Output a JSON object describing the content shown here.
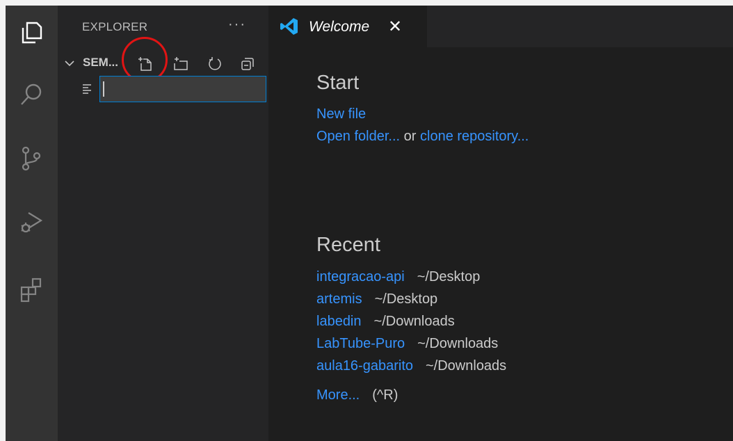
{
  "sidebar": {
    "title": "EXPLORER",
    "more_actions": "···",
    "folder_name": "SEM...",
    "new_file_input_value": ""
  },
  "tab": {
    "label": "Welcome",
    "close": "✕"
  },
  "welcome": {
    "start_heading": "Start",
    "new_file": "New file",
    "open_folder": "Open folder...",
    "or_text": "or",
    "clone_repository": "clone repository...",
    "recent_heading": "Recent",
    "recent": [
      {
        "name": "integracao-api",
        "path": "~/Desktop"
      },
      {
        "name": "artemis",
        "path": "~/Desktop"
      },
      {
        "name": "labedin",
        "path": "~/Downloads"
      },
      {
        "name": "LabTube-Puro",
        "path": "~/Downloads"
      },
      {
        "name": "aula16-gabarito",
        "path": "~/Downloads"
      }
    ],
    "more": "More...",
    "more_shortcut": "(^R)"
  },
  "icons": {
    "activity": [
      "files-icon",
      "search-icon",
      "source-control-icon",
      "run-debug-icon",
      "extensions-icon"
    ],
    "toolbar": [
      "new-file-icon",
      "new-folder-icon",
      "refresh-icon",
      "collapse-all-icon"
    ]
  },
  "colors": {
    "link": "#3794ff",
    "highlight": "#e11414",
    "focus_border": "#007fd4",
    "vscode_blue": "#23a9f2"
  }
}
